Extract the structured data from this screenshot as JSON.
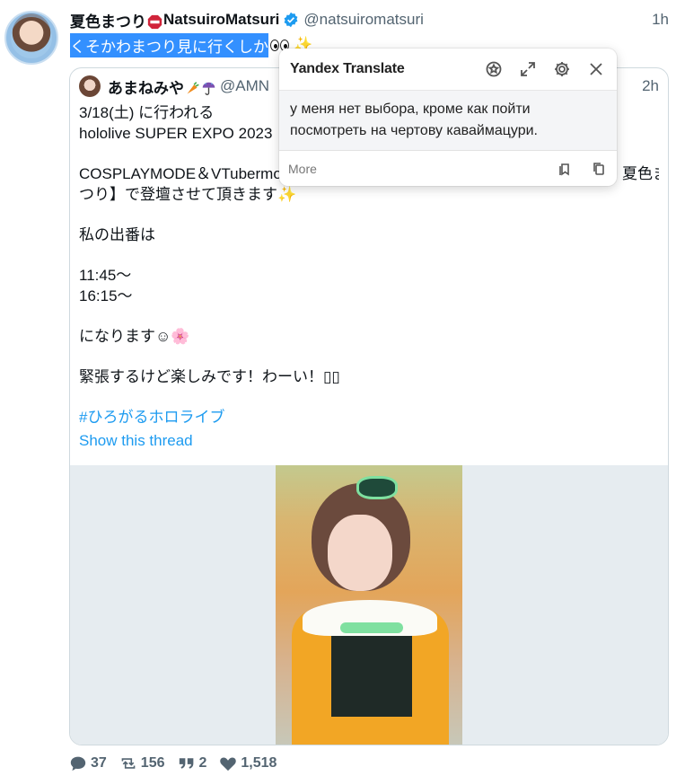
{
  "tweet": {
    "author_name": "夏色まつり",
    "author_name_latin": "NatsuiroMatsuri",
    "handle": "@natsuiromatsuri",
    "time": "1h",
    "text": "くそかわまつり見に行くしか",
    "text_emoji_eyes": "eyes-icon",
    "text_emoji_sparkle": "✨"
  },
  "quote": {
    "author_name": "あまねみや",
    "handle": "@AMN",
    "time": "2h",
    "lines": [
      "3/18(土) に行われる",
      "hololive SUPER EXPO 2023",
      "",
      "COSPLAYMODE＆VTubermo",
      "つり】で登壇させて頂きます✨",
      "",
      "私の出番は",
      "",
      "11:45～",
      "16:15～",
      "",
      "になります☺🌸",
      "",
      "緊張するけど楽しみです！わーい！▯▯"
    ],
    "overflow_tail": "夏色ま",
    "hashtag": "#ひろがるホロライブ",
    "show_thread": "Show this thread"
  },
  "actions": {
    "replies": "37",
    "retweets": "156",
    "quotes": "2",
    "likes": "1,518"
  },
  "translate_popup": {
    "title": "Yandex Translate",
    "translation": "у меня нет выбора, кроме как пойти посмотреть на чертову каваймацури.",
    "more": "More"
  },
  "colors": {
    "selection": "#3390ff",
    "link": "#1d9bf0",
    "muted": "#536471"
  }
}
